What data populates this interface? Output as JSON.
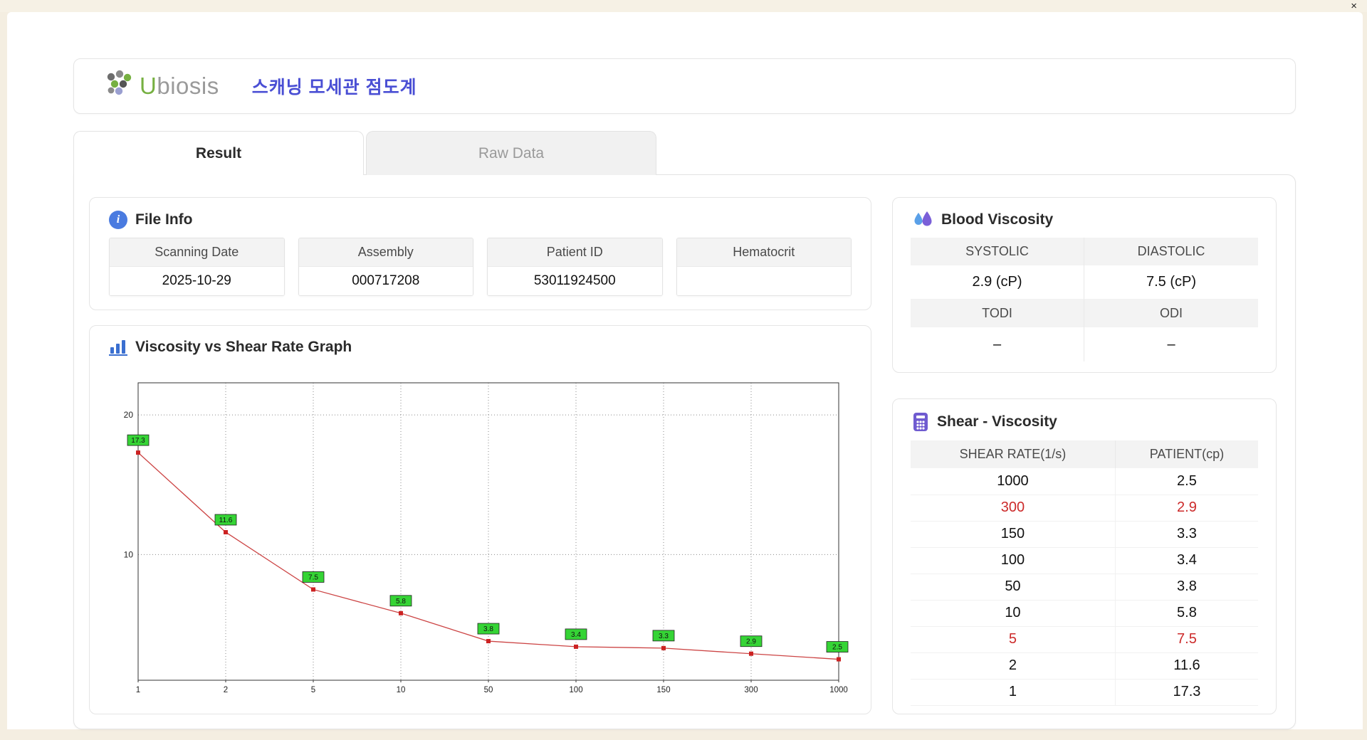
{
  "window": {
    "close_glyph": "×"
  },
  "header": {
    "logo_u": "U",
    "logo_rest": "biosis",
    "title": "스캐닝 모세관 점도계"
  },
  "tabs": [
    {
      "label": "Result",
      "active": true
    },
    {
      "label": "Raw Data",
      "active": false
    }
  ],
  "file_info": {
    "section_title": "File Info",
    "fields": [
      {
        "label": "Scanning Date",
        "value": "2025-10-29"
      },
      {
        "label": "Assembly",
        "value": "000717208"
      },
      {
        "label": "Patient ID",
        "value": "53011924500"
      },
      {
        "label": "Hematocrit",
        "value": ""
      }
    ]
  },
  "graph": {
    "section_title": "Viscosity vs Shear Rate Graph"
  },
  "blood_viscosity": {
    "section_title": "Blood Viscosity",
    "systolic_label": "SYSTOLIC",
    "systolic_value": "2.9 (cP)",
    "diastolic_label": "DIASTOLIC",
    "diastolic_value": "7.5 (cP)",
    "todi_label": "TODI",
    "todi_value": "–",
    "odi_label": "ODI",
    "odi_value": "–"
  },
  "shear_viscosity": {
    "section_title": "Shear - Viscosity",
    "columns": [
      "SHEAR RATE(1/s)",
      "PATIENT(cp)"
    ],
    "rows": [
      {
        "shear": "1000",
        "patient": "2.5",
        "highlight": false
      },
      {
        "shear": "300",
        "patient": "2.9",
        "highlight": true
      },
      {
        "shear": "150",
        "patient": "3.3",
        "highlight": false
      },
      {
        "shear": "100",
        "patient": "3.4",
        "highlight": false
      },
      {
        "shear": "50",
        "patient": "3.8",
        "highlight": false
      },
      {
        "shear": "10",
        "patient": "5.8",
        "highlight": false
      },
      {
        "shear": "5",
        "patient": "7.5",
        "highlight": true
      },
      {
        "shear": "2",
        "patient": "11.6",
        "highlight": false
      },
      {
        "shear": "1",
        "patient": "17.3",
        "highlight": false
      }
    ]
  },
  "chart_data": {
    "type": "line",
    "title": "Viscosity vs Shear Rate Graph",
    "xlabel": "",
    "ylabel": "",
    "x_categories": [
      "1",
      "2",
      "5",
      "10",
      "50",
      "100",
      "150",
      "300",
      "1000"
    ],
    "values": [
      17.3,
      11.6,
      7.5,
      5.8,
      3.8,
      3.4,
      3.3,
      2.9,
      2.5
    ],
    "point_labels": [
      "17.3",
      "11.6",
      "7.5",
      "5.8",
      "3.8",
      "3.4",
      "3.3",
      "2.9",
      "2.5"
    ],
    "y_ticks": [
      10,
      20
    ],
    "ylim": [
      1,
      22.3
    ],
    "grid": "dotted",
    "legend": "none",
    "line_color": "#cc4444",
    "marker_color": "#cc2222",
    "label_bg": "#35d435"
  }
}
